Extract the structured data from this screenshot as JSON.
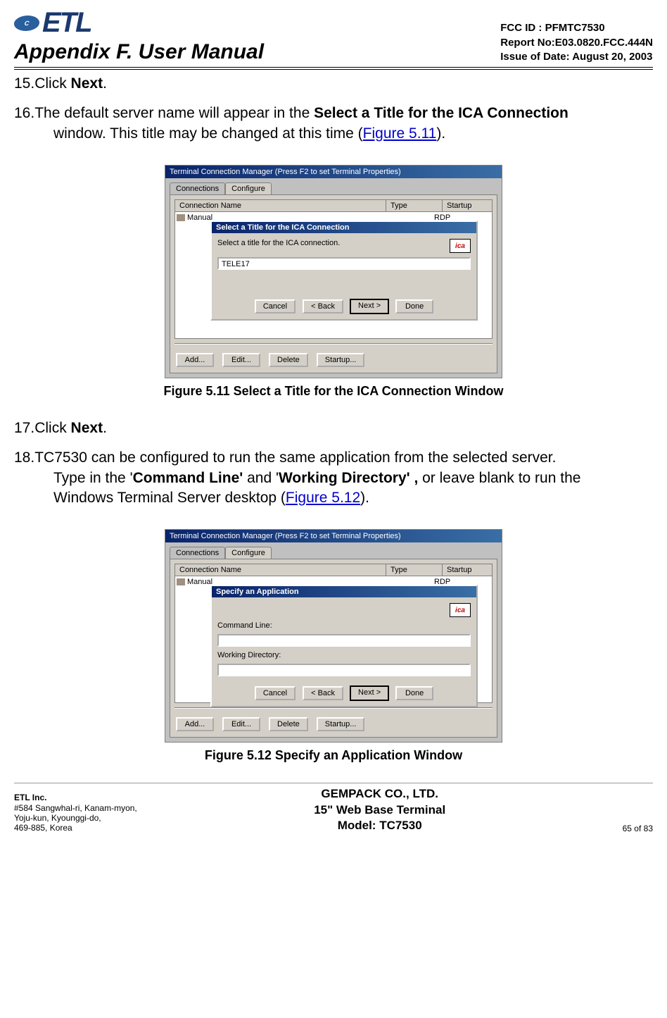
{
  "header": {
    "logo_inner": "C",
    "logo_text": "ETL",
    "appendix": "Appendix F. User Manual",
    "fcc": "FCC ID : PFMTC7530",
    "report": "Report No:E03.0820.FCC.444N",
    "issue": "Issue of Date: August 20, 2003"
  },
  "step15": {
    "num": "15.",
    "pre": "Click ",
    "bold": "Next",
    "post": "."
  },
  "step16": {
    "num": "16.",
    "line1_pre": "The default server name will appear in the ",
    "line1_bold": "Select a Title for the ICA Connection",
    "line2_pre": "window.  This title may be changed at this time (",
    "line2_link": "Figure 5.11",
    "line2_post": ")."
  },
  "fig511": {
    "titlebar": "Terminal Connection Manager  (Press F2 to set Terminal Properties)",
    "tab1": "Connections",
    "tab2": "Configure",
    "col1": "Connection Name",
    "col2": "Type",
    "col3": "Startup",
    "row_name": "Manual",
    "row_type": "RDP",
    "dlg_title": "Select a Title for the ICA Connection",
    "dlg_text": "Select a title for the ICA connection.",
    "input_val": "TELE17",
    "ica": "ica",
    "btn_cancel": "Cancel",
    "btn_back": "< Back",
    "btn_next": "Next >",
    "btn_done": "Done",
    "btn_add": "Add...",
    "btn_edit": "Edit...",
    "btn_delete": "Delete",
    "btn_startup": "Startup...",
    "caption": "Figure 5.11    Select a Title for the ICA Connection Window"
  },
  "step17": {
    "num": "17.",
    "pre": "Click ",
    "bold": "Next",
    "post": "."
  },
  "step18": {
    "num": "18.",
    "line1": "TC7530 can be configured to run the same application from the selected server.",
    "line2_pre": "Type in the '",
    "line2_b1": "Command Line'",
    "line2_mid": "  and '",
    "line2_b2": "Working Directory' ,",
    "line2_post": " or leave blank to run the",
    "line3_pre": "Windows Terminal Server desktop (",
    "line3_link": "Figure 5.12",
    "line3_post": ")."
  },
  "fig512": {
    "titlebar": "Terminal Connection Manager  (Press F2 to set Terminal Properties)",
    "tab1": "Connections",
    "tab2": "Configure",
    "col1": "Connection Name",
    "col2": "Type",
    "col3": "Startup",
    "row_name": "Manual",
    "row_type": "RDP",
    "dlg_title": "Specify an Application",
    "lbl_cmd": "Command Line:",
    "lbl_wd": "Working Directory:",
    "ica": "ica",
    "btn_cancel": "Cancel",
    "btn_back": "< Back",
    "btn_next": "Next >",
    "btn_done": "Done",
    "btn_add": "Add...",
    "btn_edit": "Edit...",
    "btn_delete": "Delete",
    "btn_startup": "Startup...",
    "caption": "Figure 5.12    Specify an Application Window"
  },
  "footer": {
    "company": "ETL Inc.",
    "addr1": "#584 Sangwhal-ri, Kanam-myon,",
    "addr2": "Yoju-kun, Kyounggi-do,",
    "addr3": "469-885, Korea",
    "center1": "GEMPACK CO., LTD.",
    "center2": "15\" Web Base Terminal",
    "center3": "Model: TC7530",
    "page": "65 of 83"
  }
}
